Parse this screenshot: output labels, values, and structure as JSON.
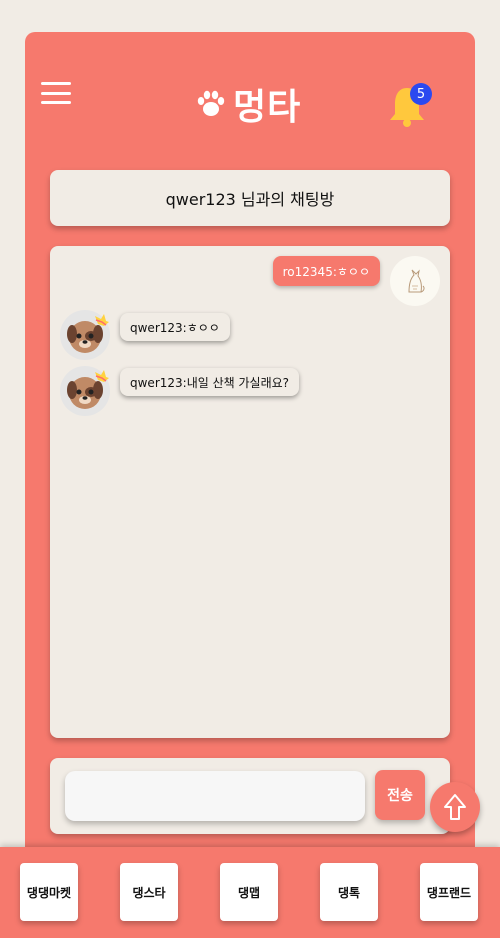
{
  "header": {
    "app_title": "멍타",
    "logo_icon": "paw-icon",
    "menu_icon": "hamburger-icon",
    "bell_icon": "bell-icon",
    "notification_count": "5"
  },
  "chat": {
    "room_title": "qwer123 님과의 채팅방",
    "messages": [
      {
        "sender": "me",
        "text": "ro12345:ㅎㅇㅇ"
      },
      {
        "sender": "other",
        "text": "qwer123:ㅎㅇㅇ"
      },
      {
        "sender": "other",
        "text": "qwer123:내일 산책 가실래요?"
      }
    ]
  },
  "composer": {
    "input_value": "",
    "send_label": "전송"
  },
  "scroll_top_icon": "arrow-up-icon",
  "bottom_nav": {
    "items": [
      {
        "label": "댕댕마켓"
      },
      {
        "label": "댕스타"
      },
      {
        "label": "댕맵"
      },
      {
        "label": "댕톡"
      },
      {
        "label": "댕프랜드"
      }
    ]
  },
  "colors": {
    "accent": "#f6796d",
    "panel": "#f1ece5",
    "badge": "#2b49f0",
    "bell": "#ffc83d"
  }
}
